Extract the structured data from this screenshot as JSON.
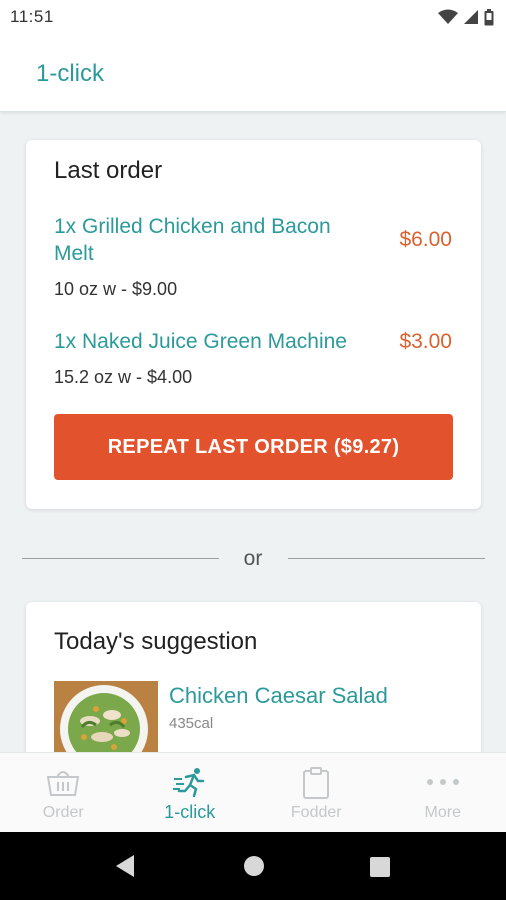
{
  "status_bar": {
    "time": "11:51",
    "icons": [
      "wifi-icon",
      "signal-icon",
      "battery-icon"
    ]
  },
  "header": {
    "title": "1-click"
  },
  "last_order": {
    "title": "Last order",
    "items": [
      {
        "name": "1x Grilled Chicken and Bacon Melt",
        "price": "$6.00",
        "desc": "10 oz w - $9.00"
      },
      {
        "name": "1x Naked Juice Green Machine",
        "price": "$3.00",
        "desc": "15.2 oz w - $4.00"
      }
    ],
    "repeat_button": "REPEAT LAST ORDER ($9.27)"
  },
  "separator": {
    "text": "or"
  },
  "suggestion": {
    "title": "Today's suggestion",
    "item": {
      "name": "Chicken Caesar Salad",
      "calories": "435cal"
    }
  },
  "tabs": [
    {
      "label": "Order",
      "icon": "basket-icon",
      "active": false
    },
    {
      "label": "1-click",
      "icon": "running-person-icon",
      "active": true
    },
    {
      "label": "Fodder",
      "icon": "clipboard-icon",
      "active": false
    },
    {
      "label": "More",
      "icon": "more-dots-icon",
      "active": false
    }
  ],
  "nav_bar": {
    "buttons": [
      "back-icon",
      "home-icon",
      "recents-icon"
    ]
  },
  "colors": {
    "teal": "#2c9a9a",
    "orange": "#e2532d",
    "price": "#d9622f"
  }
}
